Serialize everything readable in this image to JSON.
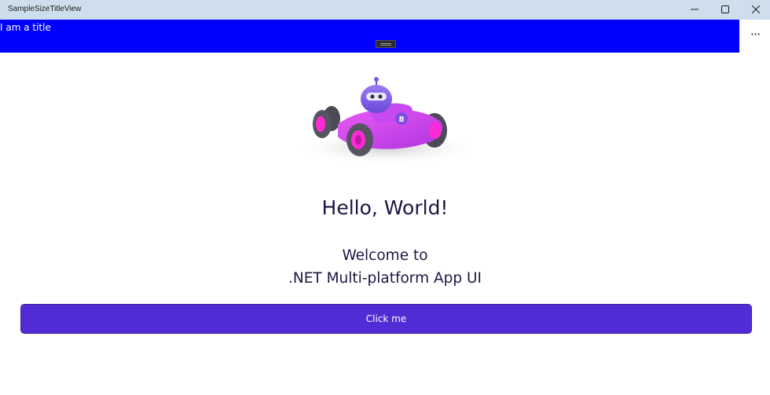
{
  "window": {
    "title": "SampleSizeTitleView"
  },
  "title_view": {
    "text": "I am a title",
    "background": "#0000ff"
  },
  "toolbar": {
    "more_label": "···"
  },
  "icons": {
    "minimize": "minimize-icon",
    "maximize": "maximize-icon",
    "close": "close-icon",
    "more": "more-options-icon",
    "pane_toggle": "pane-toggle-icon"
  },
  "main": {
    "image": "dotnet-bot-race-car",
    "heading": "Hello, World!",
    "welcome_line1": "Welcome to",
    "welcome_line2": ".NET Multi-platform App UI",
    "button_label": "Click me"
  },
  "colors": {
    "accent": "#512bd4",
    "text": "#1f1445",
    "titlebar": "#cfdeec"
  }
}
